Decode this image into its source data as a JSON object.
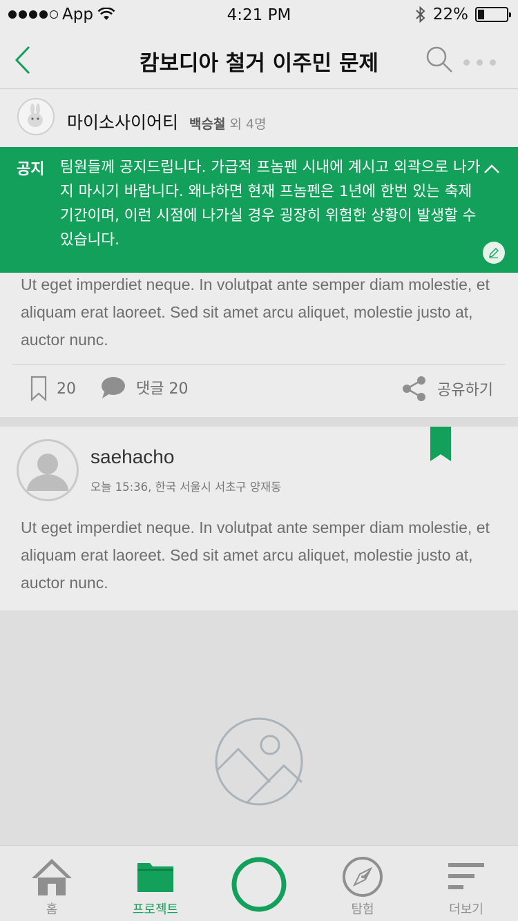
{
  "status_bar": {
    "carrier": "App",
    "time": "4:21 PM",
    "battery_percent": "22%",
    "battery_level": 0.22
  },
  "nav": {
    "title": "캄보디아 철거 이주민 문제",
    "back_icon": "chevron-left-icon",
    "search_icon": "search-icon",
    "more_icon": "more-icon"
  },
  "group": {
    "name": "마이소사이어티",
    "leader": "백승철",
    "others": "외 4명"
  },
  "notice": {
    "tag": "공지",
    "text": "팀원들께 공지드립니다. 가급적 프놈펜 시내에 계시고 외곽으로 나가지 마시기 바랍니다. 왜냐하면 현재 프놈펜은 1년에 한번 있는 축제기간이며, 이런 시점에 나가실 경우 굉장히 위험한 상황이 발생할 수 있습니다."
  },
  "post1": {
    "body": "Ut eget imperdiet neque. In volutpat ante semper diam molestie, et aliquam erat laoreet. Sed sit amet arcu aliquet, molestie justo at, auctor nunc.",
    "bookmark_count": "20",
    "comment_label": "댓글 20",
    "share_label": "공유하기"
  },
  "post2": {
    "author": "saehacho",
    "meta": "오늘 15:36, 한국 서울시 서초구 양재동",
    "body": "Ut eget imperdiet neque. In volutpat ante semper diam molestie, et aliquam erat laoreet. Sed sit amet arcu aliquet, molestie justo at, auctor nunc."
  },
  "tabs": [
    {
      "label": "홈",
      "icon": "home-icon",
      "active": false
    },
    {
      "label": "프로젝트",
      "icon": "folder-icon",
      "active": true
    },
    {
      "label": "",
      "icon": "record-icon",
      "active": false
    },
    {
      "label": "탐험",
      "icon": "compass-icon",
      "active": false
    },
    {
      "label": "더보기",
      "icon": "menu-icon",
      "active": false
    }
  ],
  "colors": {
    "accent": "#13a05b",
    "text_gray": "#6e6e6e",
    "icon_gray": "#8f8f8f"
  }
}
